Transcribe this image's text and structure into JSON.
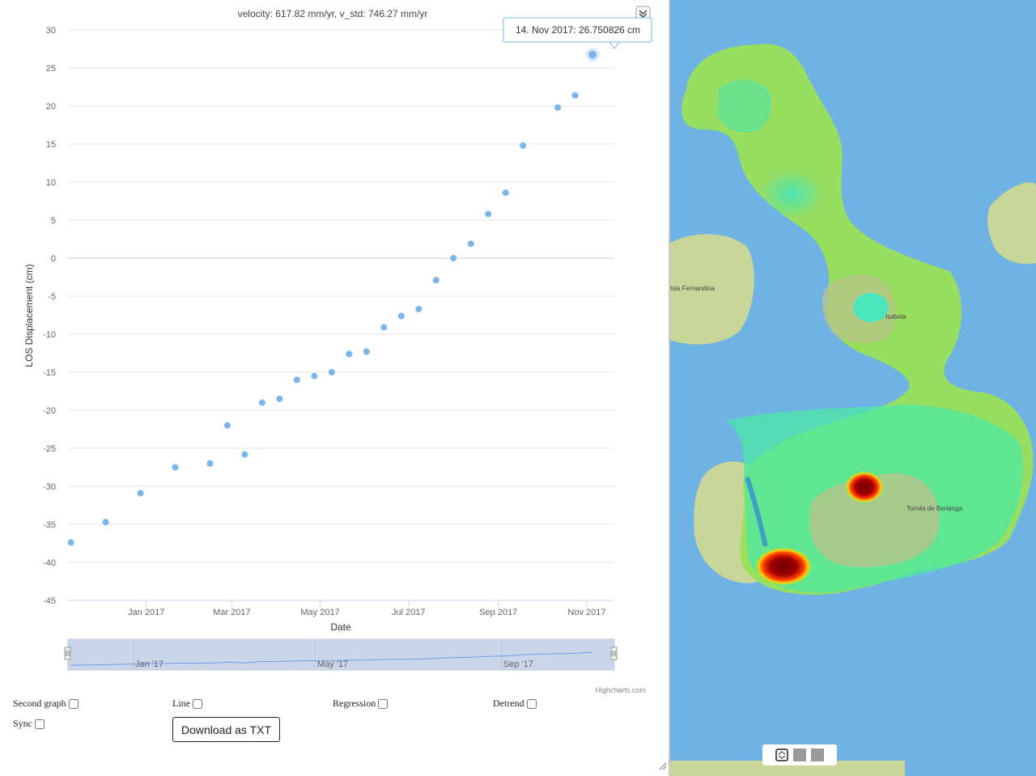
{
  "chart": {
    "title": "velocity: 617.82 mm/yr, v_std: 746.27 mm/yr",
    "ylabel": "LOS Displacement (cm)",
    "xlabel": "Date",
    "credits": "Highcharts.com",
    "tooltip": "14. Nov 2017: 26.750826 cm",
    "y_ticks": [
      "30",
      "25",
      "20",
      "15",
      "10",
      "5",
      "0",
      "-5",
      "-10",
      "-15",
      "-20",
      "-25",
      "-30",
      "-35",
      "-40",
      "-45"
    ],
    "x_ticks": [
      "Jan 2017",
      "Mar 2017",
      "May 2017",
      "Jul 2017",
      "Sep 2017",
      "Nov 2017"
    ],
    "navigator_ticks": [
      "Jan '17",
      "May '17",
      "Sep '17"
    ],
    "point_color": "#7cb5ec",
    "chart_data": {
      "type": "scatter",
      "title": "velocity: 617.82 mm/yr, v_std: 746.27 mm/yr",
      "xlabel": "Date",
      "ylabel": "LOS Displacement (cm)",
      "ylim": [
        -45,
        30
      ],
      "xlim": [
        "2016-11-08",
        "2017-11-20"
      ],
      "x": [
        "2016-11-10",
        "2016-12-04",
        "2016-12-28",
        "2017-01-21",
        "2017-02-14",
        "2017-02-26",
        "2017-03-10",
        "2017-03-22",
        "2017-04-03",
        "2017-04-15",
        "2017-04-27",
        "2017-05-09",
        "2017-05-21",
        "2017-06-02",
        "2017-06-14",
        "2017-06-26",
        "2017-07-08",
        "2017-07-20",
        "2017-08-01",
        "2017-08-13",
        "2017-08-25",
        "2017-09-06",
        "2017-09-18",
        "2017-10-12",
        "2017-10-24",
        "2017-11-05",
        "2017-11-14"
      ],
      "y": [
        -37.4,
        -34.7,
        -30.9,
        -27.5,
        -27.0,
        -22.0,
        -25.8,
        -19.0,
        -18.5,
        -16.0,
        -15.5,
        -15.0,
        -12.6,
        -12.3,
        -9.1,
        -7.6,
        -6.7,
        -2.9,
        0.0,
        1.9,
        5.8,
        8.6,
        14.8,
        19.8,
        21.4,
        26.750826
      ],
      "grid": true,
      "legend": "none"
    }
  },
  "controls": {
    "second_graph": "Second graph",
    "line": "Line",
    "regression": "Regression",
    "detrend": "Detrend",
    "sync": "Sync",
    "download": "Download as TXT"
  },
  "map": {
    "labels": [
      "Isla Fernandina",
      "Isabela",
      "Tomás de Berlanga"
    ],
    "ocean_color": "#6fb2e4",
    "land_color": "#c9d69a"
  }
}
